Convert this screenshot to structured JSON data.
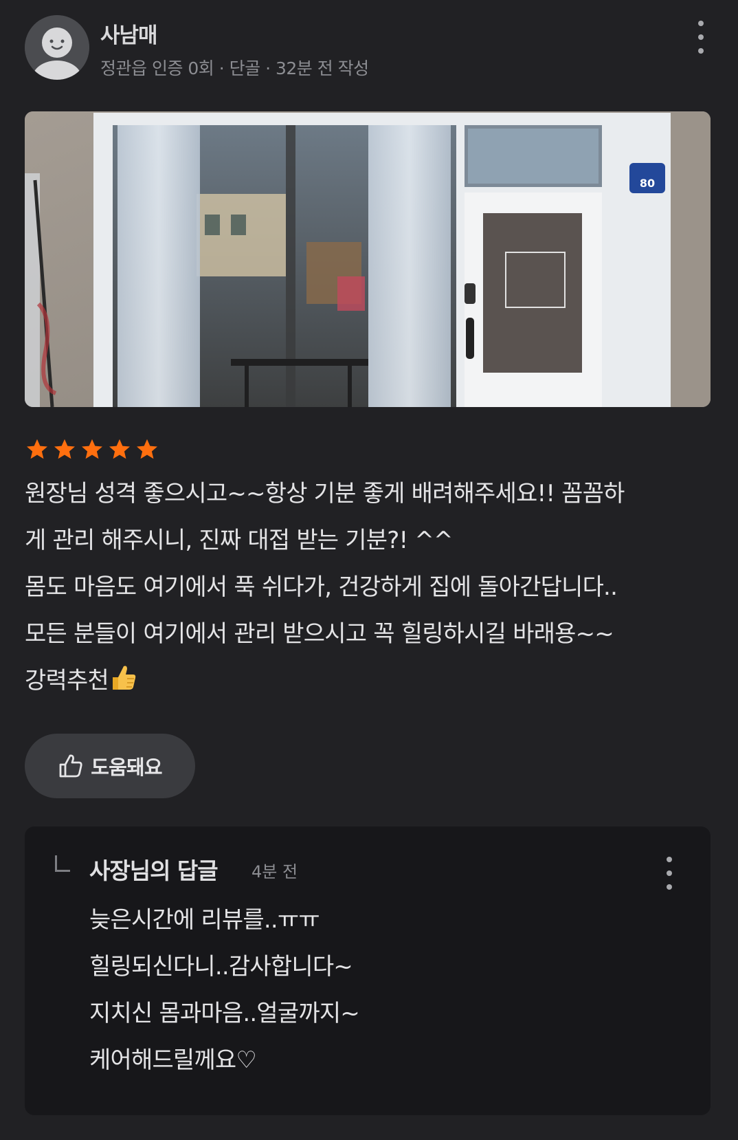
{
  "author": {
    "name": "사남매",
    "meta": "정관읍 인증 0회 · 단골 · 32분 전 작성"
  },
  "photo": {
    "house_number": "80"
  },
  "rating": {
    "stars": 5,
    "max": 5,
    "color": "#ff6f0f"
  },
  "review": {
    "lines": [
      "원장님 성격 좋으시고~~항상 기분 좋게 배려해주세요!! 꼼꼼하",
      "게 관리 해주시니, 진짜 대접 받는 기분?! ^^",
      "몸도 마음도 여기에서 푹 쉬다가, 건강하게 집에 돌아간답니다..",
      "모든 분들이 여기에서 관리 받으시고 꼭 힐링하시길 바래용~~",
      "강력추천"
    ]
  },
  "helpful": {
    "label": "도움돼요",
    "icon": "thumbs-up-outline-icon"
  },
  "reply": {
    "title": "사장님의 답글",
    "time": "4분 전",
    "lines": [
      "늦은시간에 리뷰를..ㅠㅠ",
      "힐링되신다니..감사합니다~",
      "지치신 몸과마음..얼굴까지~",
      "케어해드릴께요♡"
    ]
  }
}
